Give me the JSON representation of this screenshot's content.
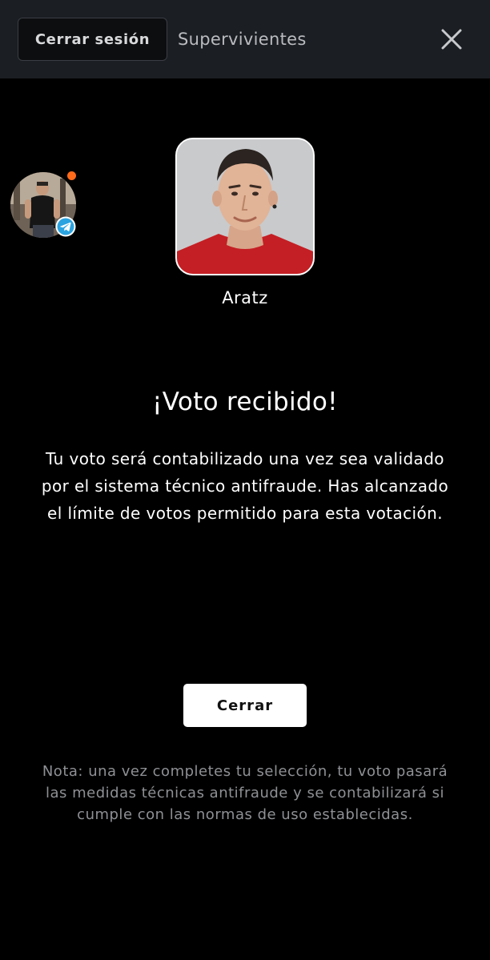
{
  "header": {
    "logout_label": "Cerrar sesión",
    "title": "Supervivientes",
    "close_icon": "close-icon"
  },
  "floating_avatar": {
    "badge_icon": "telegram-icon",
    "notification_color": "#ff6a1a"
  },
  "candidate": {
    "name": "Aratz"
  },
  "confirmation": {
    "title": "¡Voto recibido!",
    "message": "Tu voto será contabilizado una vez sea validado por el sistema técnico antifraude. Has alcanzado el límite de votos permitido para esta votación."
  },
  "actions": {
    "close_label": "Cerrar"
  },
  "note": {
    "text": "Nota: una vez completes tu selección, tu voto pasará las medidas técnicas antifraude y se contabilizará si cumple con las normas de uso establecidas."
  },
  "colors": {
    "background": "#000000",
    "header_background": "#1b1e23",
    "accent_orange": "#ff6a1a",
    "telegram_blue": "#2aa3e0"
  }
}
